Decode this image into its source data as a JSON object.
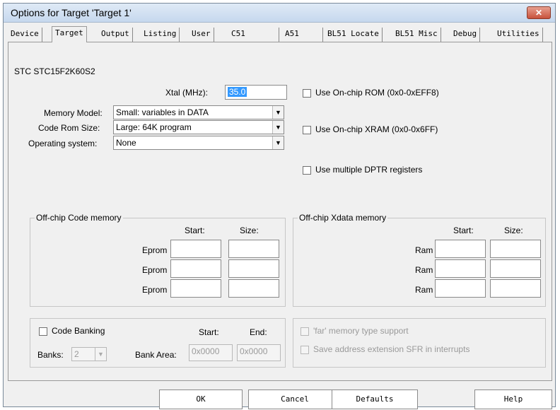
{
  "window": {
    "title": "Options for Target 'Target 1'",
    "close_glyph": "✕"
  },
  "tabs": [
    "Device",
    "Target",
    "Output",
    "Listing",
    "User",
    "C51",
    "A51",
    "BL51 Locate",
    "BL51 Misc",
    "Debug",
    "Utilities"
  ],
  "active_tab": "Target",
  "target": {
    "device_name": "STC STC15F2K60S2",
    "xtal": {
      "label": "Xtal (MHz):",
      "value": "35.0"
    },
    "memory_model": {
      "label": "Memory Model:",
      "value": "Small: variables in DATA"
    },
    "code_rom_size": {
      "label": "Code Rom Size:",
      "value": "Large: 64K program"
    },
    "operating_system": {
      "label": "Operating system:",
      "value": "None"
    },
    "use_onchip_rom": {
      "label": "Use On-chip ROM (0x0-0xEFF8)",
      "checked": false
    },
    "use_onchip_xram": {
      "label": "Use On-chip XRAM (0x0-0x6FF)",
      "checked": false
    },
    "use_multiple_dptr": {
      "label": "Use multiple DPTR registers",
      "checked": false
    }
  },
  "code_memory": {
    "title": "Off-chip Code memory",
    "start_header": "Start:",
    "size_header": "Size:",
    "rows": [
      {
        "label": "Eprom",
        "start": "",
        "size": ""
      },
      {
        "label": "Eprom",
        "start": "",
        "size": ""
      },
      {
        "label": "Eprom",
        "start": "",
        "size": ""
      }
    ]
  },
  "xdata_memory": {
    "title": "Off-chip Xdata memory",
    "start_header": "Start:",
    "size_header": "Size:",
    "rows": [
      {
        "label": "Ram",
        "start": "",
        "size": ""
      },
      {
        "label": "Ram",
        "start": "",
        "size": ""
      },
      {
        "label": "Ram",
        "start": "",
        "size": ""
      }
    ]
  },
  "banking": {
    "code_banking_label": "Code Banking",
    "code_banking_checked": false,
    "start_header": "Start:",
    "end_header": "End:",
    "banks_label": "Banks:",
    "banks_value": "2",
    "bank_area_label": "Bank Area:",
    "bank_area_start": "0x0000",
    "bank_area_end": "0x0000"
  },
  "far": {
    "far_memory_label": "'far' memory type support",
    "save_sfr_label": "Save address extension SFR in interrupts"
  },
  "buttons": {
    "ok": "OK",
    "cancel": "Cancel",
    "defaults": "Defaults",
    "help": "Help"
  },
  "colors": {
    "selection": "#3399ff",
    "close_button": "#c8523c"
  }
}
